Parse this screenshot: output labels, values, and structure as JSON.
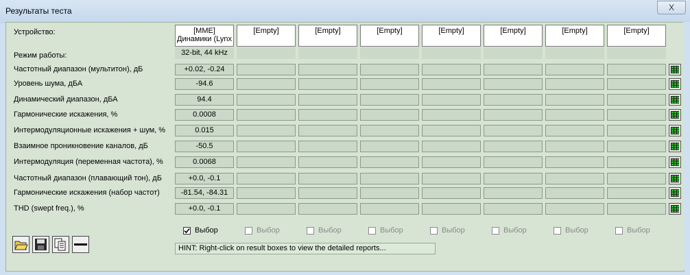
{
  "window": {
    "title": "Результаты теста",
    "close_label": "X"
  },
  "device_label": "Устройство:",
  "devices": [
    {
      "line1": "[MME]",
      "line2": "Динамики (Lynx"
    },
    {
      "line1": "[Empty]",
      "line2": ""
    },
    {
      "line1": "[Empty]",
      "line2": ""
    },
    {
      "line1": "[Empty]",
      "line2": ""
    },
    {
      "line1": "[Empty]",
      "line2": ""
    },
    {
      "line1": "[Empty]",
      "line2": ""
    },
    {
      "line1": "[Empty]",
      "line2": ""
    },
    {
      "line1": "[Empty]",
      "line2": ""
    }
  ],
  "mode": {
    "label": "Режим работы:",
    "value": "32-bit, 44 kHz"
  },
  "rows": [
    {
      "label": "Частотный диапазон (мультитон), дБ",
      "value": "+0.02, -0.24"
    },
    {
      "label": "Уровень шума, дБА",
      "value": "-94.6"
    },
    {
      "label": "Динамический диапазон, дБА",
      "value": "94.4"
    },
    {
      "label": "Гармонические искажения, %",
      "value": "0.0008"
    },
    {
      "label": "Интермодуляционные искажения + шум, %",
      "value": "0.015"
    },
    {
      "label": "Взаимное проникновение каналов, дБ",
      "value": "-50.5"
    },
    {
      "label": "Интермодуляция (переменная частота), %",
      "value": "0.0068"
    },
    {
      "label": "Частотный диапазон (плавающий тон), дБ",
      "value": "+0.0, -0.1"
    },
    {
      "label": "Гармонические искажения (набор частот)",
      "value": "-81.54, -84.31"
    },
    {
      "label": "THD (swept freq.), %",
      "value": "+0.0, -0.1"
    }
  ],
  "select_label": "Выбор",
  "selections": [
    true,
    false,
    false,
    false,
    false,
    false,
    false,
    false
  ],
  "toolbar": [
    "open-folder-icon",
    "save-disk-icon",
    "copy-pages-icon",
    "minus-icon"
  ],
  "hint": "HINT: Right-click on result boxes to view the detailed reports...",
  "colors": {
    "panel": "#d7e4d4",
    "cell": "#cbdac8",
    "grid_icon": "#1a8a1a"
  }
}
